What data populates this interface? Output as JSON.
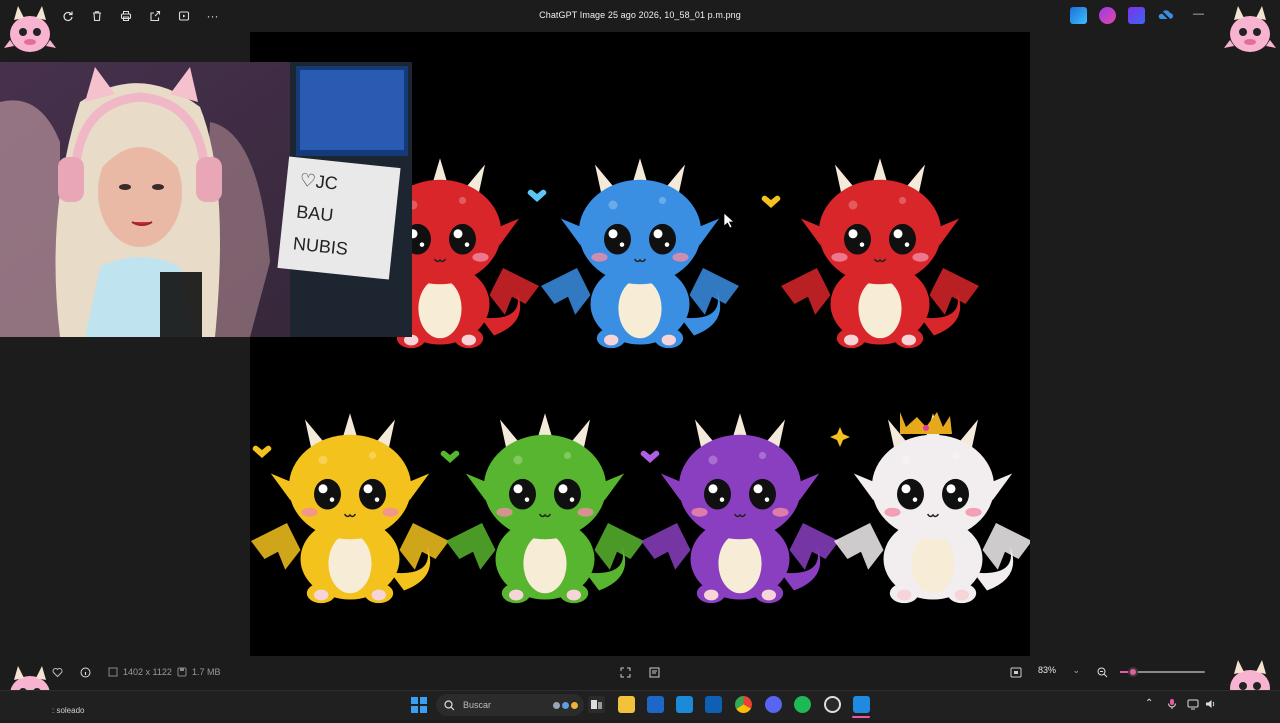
{
  "window": {
    "title": "ChatGPT Image 25 ago 2026, 10_58_01 p.m.png"
  },
  "toolbar": {
    "icons": [
      "rotate-icon",
      "delete-icon",
      "print-icon",
      "share-icon",
      "slideshow-icon",
      "more-icon"
    ],
    "more_label": "···"
  },
  "status": {
    "dimensions": "1402 x 1122",
    "file_size": "1.7 MB",
    "zoom": "83%",
    "zoom_level_percent": 15
  },
  "taskbar": {
    "weather": ": soleado",
    "search_placeholder": "Buscar"
  },
  "colors": {
    "accent": "#e85aa6",
    "background": "#1c1c1c",
    "canvas": "#000000",
    "taskbar": "#202020"
  },
  "canvas": {
    "dragons": [
      {
        "name": "red-dragon-partial",
        "color": "#d8262a"
      },
      {
        "name": "blue-dragon",
        "color": "#3a8fe3"
      },
      {
        "name": "red-dragon",
        "color": "#d8262a"
      },
      {
        "name": "yellow-dragon",
        "color": "#f3c21d"
      },
      {
        "name": "green-dragon",
        "color": "#58b52f"
      },
      {
        "name": "purple-dragon",
        "color": "#8a3fc0"
      },
      {
        "name": "white-dragon-crown",
        "color": "#f2eef0"
      }
    ]
  },
  "webcam": {
    "lightbox_text": "♡JC BAU NUBIS"
  }
}
